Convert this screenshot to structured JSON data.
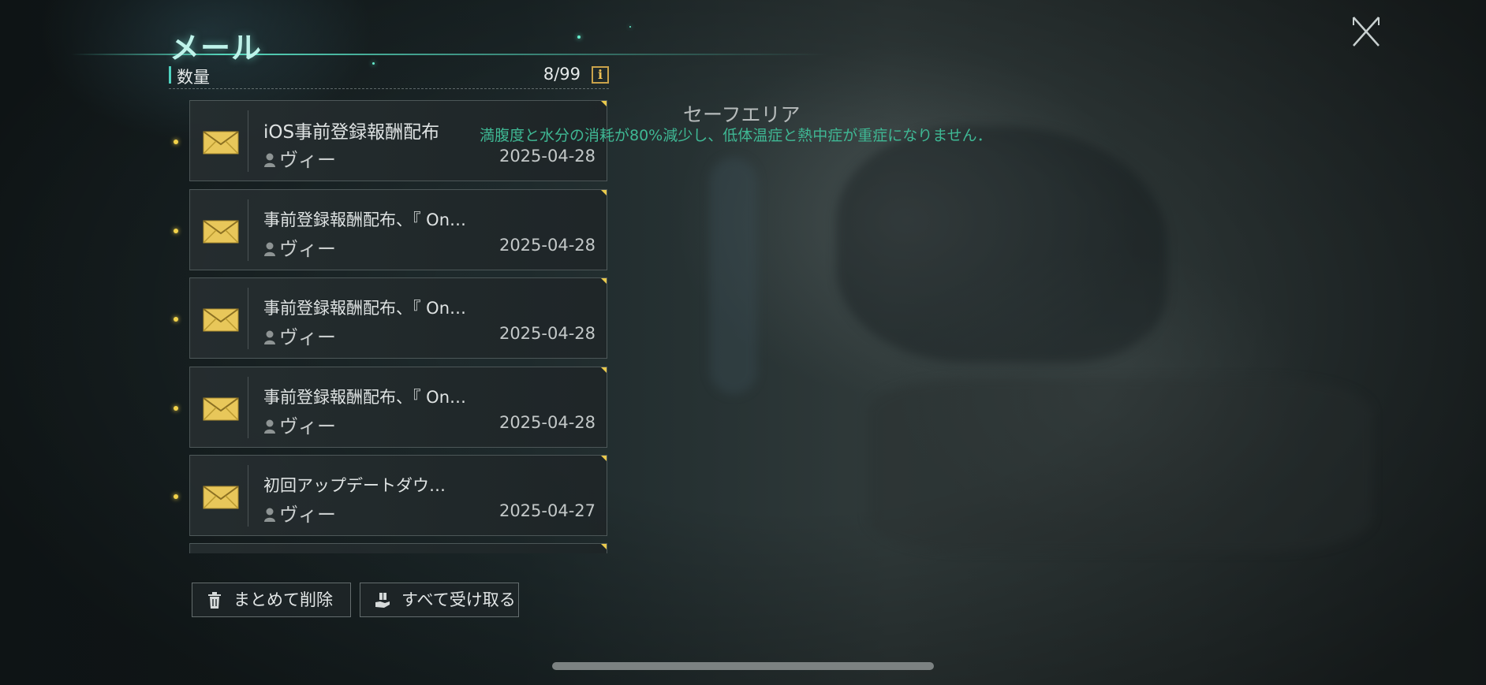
{
  "page": {
    "title": "メール"
  },
  "header": {
    "count_label": "数量",
    "count_value": "8/99",
    "info_icon": "info-icon",
    "close_icon": "close-icon"
  },
  "mails": [
    {
      "subject": "iOS事前登録報酬配布",
      "sender": "ヴィー",
      "date": "2025-04-28",
      "unread": true
    },
    {
      "subject": "事前登録報酬配布、『 On…",
      "sender": "ヴィー",
      "date": "2025-04-28",
      "unread": true
    },
    {
      "subject": "事前登録報酬配布、『 On…",
      "sender": "ヴィー",
      "date": "2025-04-28",
      "unread": true
    },
    {
      "subject": "事前登録報酬配布、『 On…",
      "sender": "ヴィー",
      "date": "2025-04-28",
      "unread": true
    },
    {
      "subject": "初回アップデートダウ…",
      "sender": "ヴィー",
      "date": "2025-04-27",
      "unread": true
    }
  ],
  "actions": {
    "delete_label": "まとめて削除",
    "claim_label": "すべて受け取る"
  },
  "zone": {
    "title": "セーフエリア",
    "description": "満腹度と水分の消耗が80%減少し、低体温症と熱中症が重症になりません．"
  },
  "colors": {
    "accent": "#4fd3c0",
    "envelope": "#e8c75a",
    "unread_dot": "#f2d24a",
    "zone_text": "#3fb894"
  }
}
